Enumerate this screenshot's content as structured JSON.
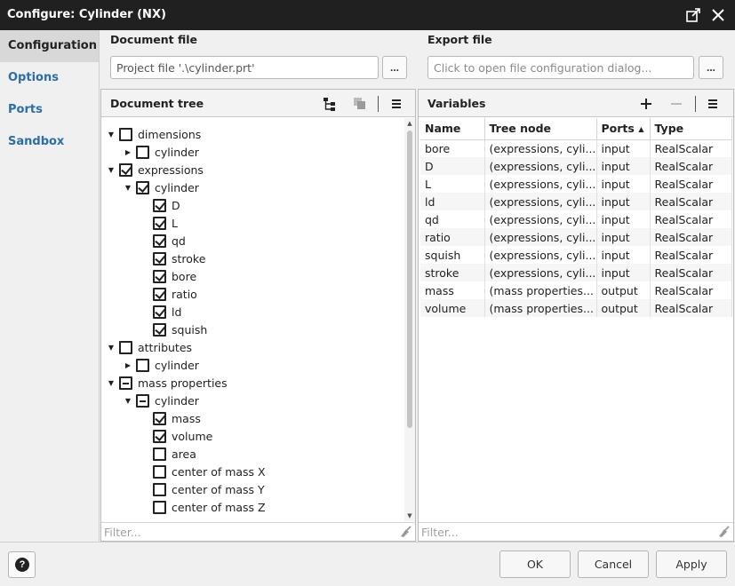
{
  "window": {
    "title": "Configure: Cylinder (NX)"
  },
  "nav": {
    "items": [
      "Configuration",
      "Options",
      "Ports",
      "Sandbox"
    ],
    "active": 0
  },
  "document_file": {
    "label": "Document file",
    "value": "Project file '.\\cylinder.prt'",
    "browse_label": "..."
  },
  "export_file": {
    "label": "Export file",
    "placeholder": "Click to open file configuration dialog...",
    "browse_label": "..."
  },
  "document_tree": {
    "title": "Document tree",
    "filter_placeholder": "Filter...",
    "nodes": [
      {
        "label": "dimensions",
        "level": 0,
        "arrow": "down",
        "state": "unchecked"
      },
      {
        "label": "cylinder",
        "level": 1,
        "arrow": "right",
        "state": "unchecked"
      },
      {
        "label": "expressions",
        "level": 0,
        "arrow": "down",
        "state": "checked"
      },
      {
        "label": "cylinder",
        "level": 1,
        "arrow": "down",
        "state": "checked"
      },
      {
        "label": "D",
        "level": 2,
        "arrow": "",
        "state": "checked"
      },
      {
        "label": "L",
        "level": 2,
        "arrow": "",
        "state": "checked"
      },
      {
        "label": "qd",
        "level": 2,
        "arrow": "",
        "state": "checked"
      },
      {
        "label": "stroke",
        "level": 2,
        "arrow": "",
        "state": "checked"
      },
      {
        "label": "bore",
        "level": 2,
        "arrow": "",
        "state": "checked"
      },
      {
        "label": "ratio",
        "level": 2,
        "arrow": "",
        "state": "checked"
      },
      {
        "label": "ld",
        "level": 2,
        "arrow": "",
        "state": "checked"
      },
      {
        "label": "squish",
        "level": 2,
        "arrow": "",
        "state": "checked"
      },
      {
        "label": "attributes",
        "level": 0,
        "arrow": "down",
        "state": "unchecked"
      },
      {
        "label": "cylinder",
        "level": 1,
        "arrow": "right",
        "state": "unchecked"
      },
      {
        "label": "mass properties",
        "level": 0,
        "arrow": "down",
        "state": "partial"
      },
      {
        "label": "cylinder",
        "level": 1,
        "arrow": "down",
        "state": "partial"
      },
      {
        "label": "mass",
        "level": 2,
        "arrow": "",
        "state": "checked"
      },
      {
        "label": "volume",
        "level": 2,
        "arrow": "",
        "state": "checked"
      },
      {
        "label": "area",
        "level": 2,
        "arrow": "",
        "state": "unchecked"
      },
      {
        "label": "center of mass X",
        "level": 2,
        "arrow": "",
        "state": "unchecked"
      },
      {
        "label": "center of mass Y",
        "level": 2,
        "arrow": "",
        "state": "unchecked"
      },
      {
        "label": "center of mass Z",
        "level": 2,
        "arrow": "",
        "state": "unchecked"
      }
    ]
  },
  "variables": {
    "title": "Variables",
    "filter_placeholder": "Filter...",
    "columns": [
      "Name",
      "Tree node",
      "Ports",
      "Type"
    ],
    "sorted_column": "Ports",
    "rows": [
      [
        "bore",
        "(expressions, cyli...",
        "input",
        "RealScalar"
      ],
      [
        "D",
        "(expressions, cyli...",
        "input",
        "RealScalar"
      ],
      [
        "L",
        "(expressions, cyli...",
        "input",
        "RealScalar"
      ],
      [
        "ld",
        "(expressions, cyli...",
        "input",
        "RealScalar"
      ],
      [
        "qd",
        "(expressions, cyli...",
        "input",
        "RealScalar"
      ],
      [
        "ratio",
        "(expressions, cyli...",
        "input",
        "RealScalar"
      ],
      [
        "squish",
        "(expressions, cyli...",
        "input",
        "RealScalar"
      ],
      [
        "stroke",
        "(expressions, cyli...",
        "input",
        "RealScalar"
      ],
      [
        "mass",
        "(mass properties...",
        "output",
        "RealScalar"
      ],
      [
        "volume",
        "(mass properties...",
        "output",
        "RealScalar"
      ]
    ]
  },
  "buttons": {
    "help": "?",
    "ok": "OK",
    "cancel": "Cancel",
    "apply": "Apply"
  },
  "icons": {
    "popout": "popout-icon",
    "close": "close-icon",
    "tree_toggle": "tree-structure-icon",
    "copy": "copy-icon",
    "menu": "hamburger-menu-icon",
    "add": "plus-icon",
    "remove": "minus-icon",
    "filter_clear": "broom-icon",
    "help": "question-circle-icon"
  },
  "colors": {
    "titlebar": "#202020",
    "nav_link": "#2b6ea9",
    "nav_active_bg": "#d8d8d8"
  }
}
